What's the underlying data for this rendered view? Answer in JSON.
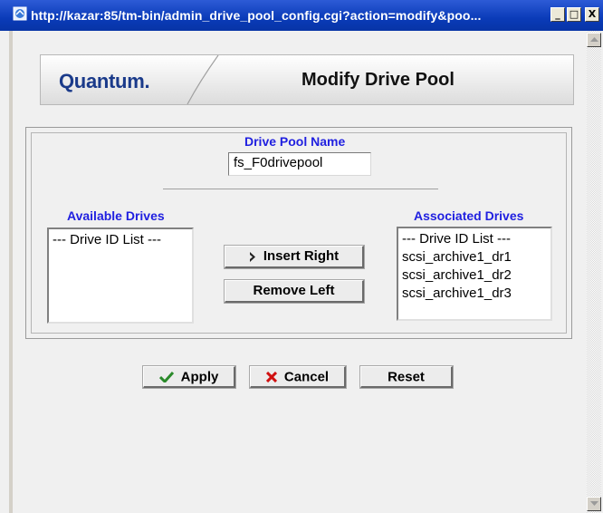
{
  "window": {
    "title": "http://kazar:85/tm-bin/admin_drive_pool_config.cgi?action=modify&poo...",
    "minimize_glyph": "_",
    "maximize_glyph": "□",
    "close_glyph": "X"
  },
  "header": {
    "logo": "Quantum.",
    "title": "Modify Drive Pool"
  },
  "form": {
    "pool_name_label": "Drive Pool Name",
    "pool_name_value": "fs_F0drivepool",
    "available_label": "Available Drives",
    "available_items": [
      "--- Drive ID List ---"
    ],
    "associated_label": "Associated Drives",
    "associated_items": [
      "--- Drive ID List ---",
      "scsi_archive1_dr1",
      "scsi_archive1_dr2",
      "scsi_archive1_dr3"
    ],
    "insert_right_label": "Insert Right",
    "remove_left_label": "Remove Left"
  },
  "actions": {
    "apply_label": "Apply",
    "cancel_label": "Cancel",
    "reset_label": "Reset"
  },
  "colors": {
    "label_blue": "#2020e0",
    "apply_check_green": "#2a8a2a",
    "cancel_x_red": "#d01010",
    "logo_blue": "#1a3a8a"
  },
  "icons": [
    "browser-page-icon",
    "insert-right-arrow-icon",
    "apply-check-icon",
    "cancel-x-icon",
    "scroll-up-icon",
    "scroll-down-icon"
  ]
}
